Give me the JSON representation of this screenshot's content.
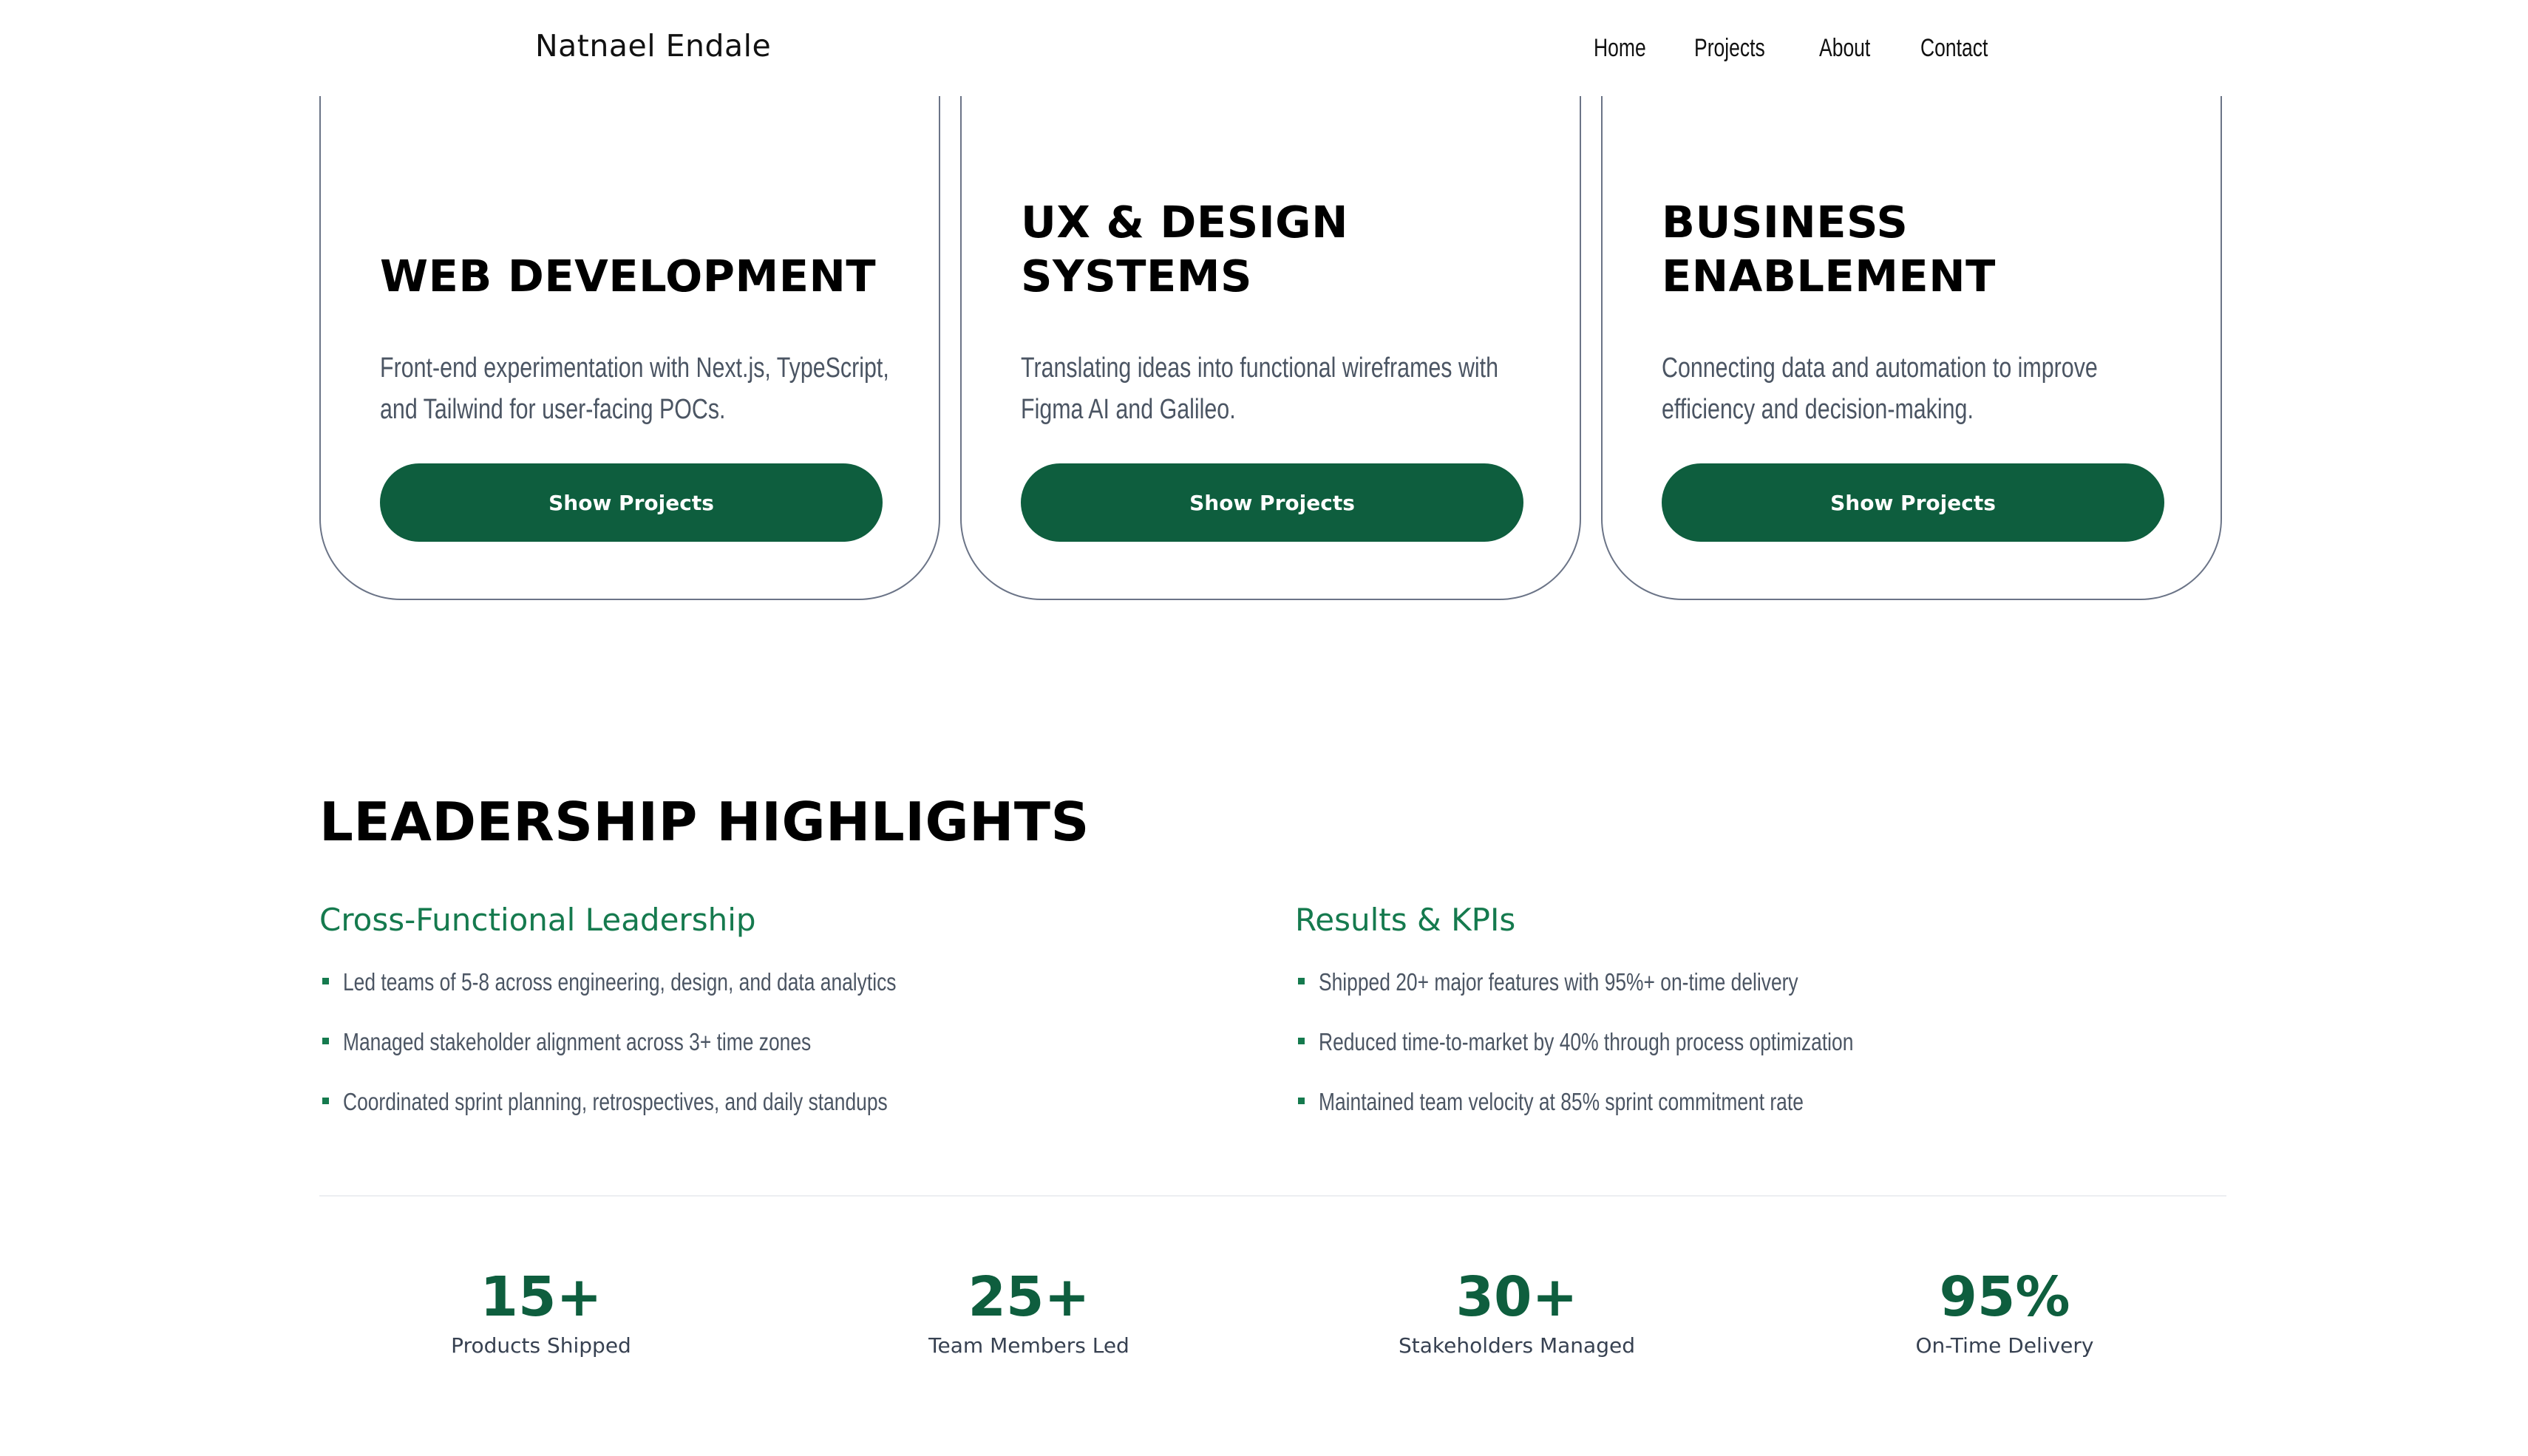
{
  "header": {
    "brand": "Natnael Endale",
    "nav": [
      "Home",
      "Projects",
      "About",
      "Contact"
    ]
  },
  "services": [
    {
      "title": "WEB DEVELOPMENT",
      "description": "Front-end experimentation with Next.js, TypeScript, and Tailwind for user-facing POCs.",
      "button": "Show Projects"
    },
    {
      "title": "UX & DESIGN SYSTEMS",
      "description": "Translating ideas into functional wireframes with Figma AI and Galileo.",
      "button": "Show Projects"
    },
    {
      "title": "BUSINESS ENABLEMENT",
      "description": "Connecting data and automation to improve efficiency and decision-making.",
      "button": "Show Projects"
    }
  ],
  "leadership": {
    "title": "LEADERSHIP HIGHLIGHTS",
    "columns": [
      {
        "heading": "Cross-Functional Leadership",
        "items": [
          "Led teams of 5-8 across engineering, design, and data analytics",
          "Managed stakeholder alignment across 3+ time zones",
          "Coordinated sprint planning, retrospectives, and daily standups"
        ]
      },
      {
        "heading": "Results & KPIs",
        "items": [
          "Shipped 20+ major features with 95%+ on-time delivery",
          "Reduced time-to-market by 40% through process optimization",
          "Maintained team velocity at 85% sprint commitment rate"
        ]
      }
    ]
  },
  "stats": [
    {
      "value": "15+",
      "label": "Products Shipped"
    },
    {
      "value": "25+",
      "label": "Team Members Led"
    },
    {
      "value": "30+",
      "label": "Stakeholders Managed"
    },
    {
      "value": "95%",
      "label": "On-Time Delivery"
    }
  ],
  "colors": {
    "accent_green": "#0e5e3e",
    "heading_green": "#157a4e",
    "card_border": "#6b7487",
    "body_text": "#4b5563"
  }
}
